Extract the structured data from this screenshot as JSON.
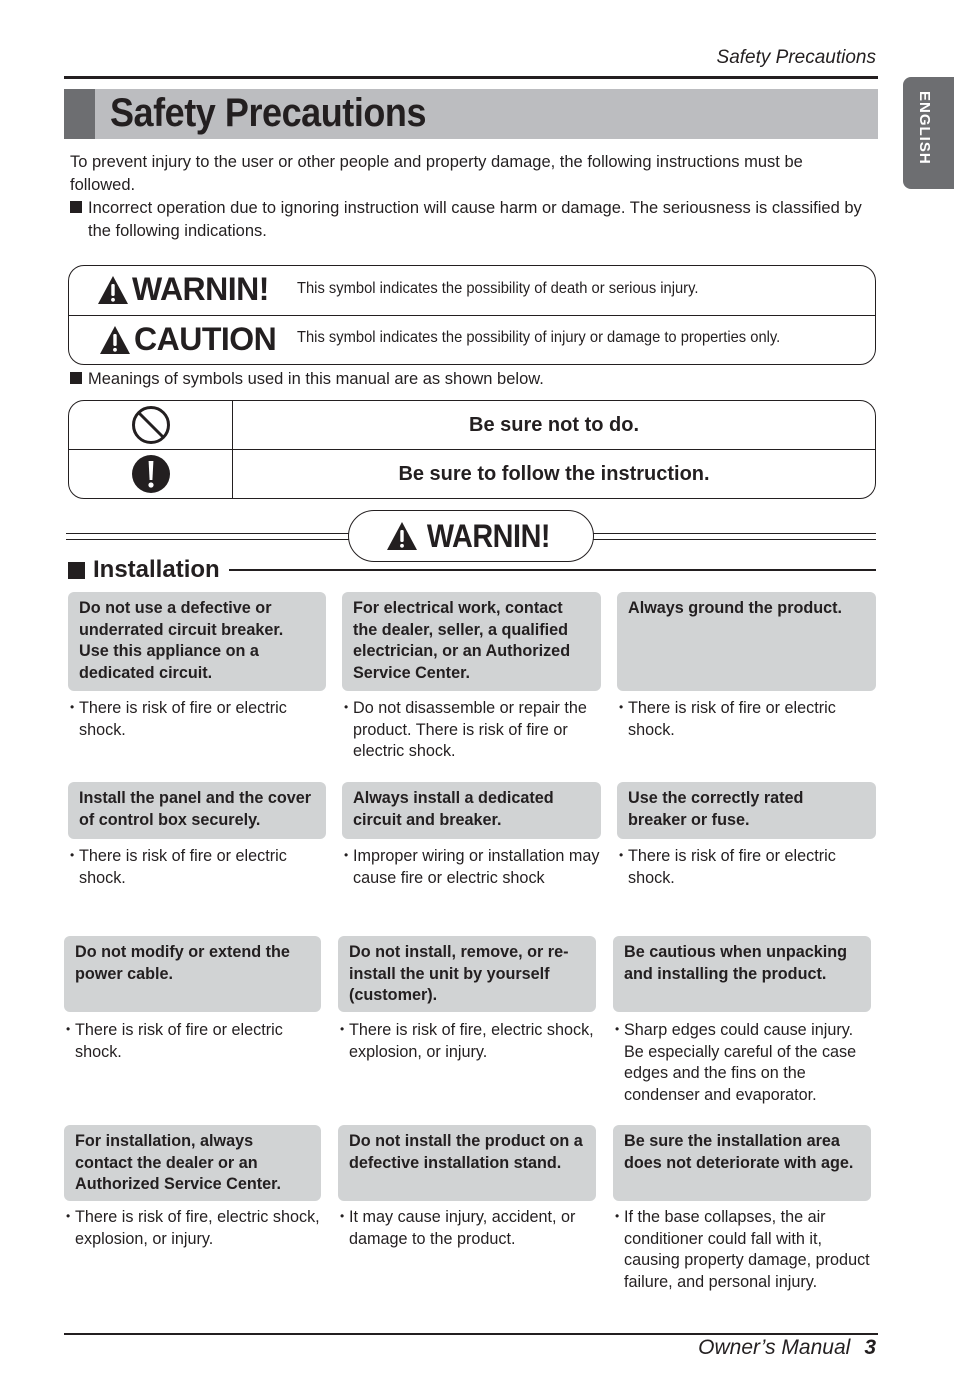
{
  "header": {
    "running_title": "Safety Precautions",
    "page_title": "Safety Precautions",
    "language_tab": "ENGLISH"
  },
  "intro": {
    "paragraph": "To prevent injury to the user or other people and property damage, the following instructions must be followed.",
    "bullet": "Incorrect operation due to ignoring instruction will cause harm or damage. The seriousness is classified by the following indications."
  },
  "severity_legend": [
    {
      "label": "WARNIN!",
      "icon": "warning-triangle-icon",
      "description": "This symbol indicates the possibility of death or serious injury."
    },
    {
      "label": "CAUTION",
      "icon": "warning-triangle-icon",
      "description": "This symbol indicates the possibility of injury or damage to properties only."
    }
  ],
  "symbols_note": "Meanings of symbols used in this manual are as shown below.",
  "symbols": [
    {
      "icon": "prohibited-icon",
      "meaning": "Be sure not to do."
    },
    {
      "icon": "mandatory-exclamation-icon",
      "meaning": "Be sure to follow the instruction."
    }
  ],
  "warning_banner": {
    "label": "WARNIN!",
    "icon": "warning-triangle-icon"
  },
  "section": {
    "title": "Installation",
    "items": [
      {
        "heading": "Do not use a defective or underrated circuit breaker. Use this appliance on a dedicated circuit.",
        "note": "There is risk of fire or electric shock."
      },
      {
        "heading": "For electrical work, contact the dealer, seller, a qualified electrician, or an Authorized Service Center.",
        "note": "Do not disassemble or repair the product. There is risk of fire or electric shock."
      },
      {
        "heading": "Always ground the product.",
        "note": "There is risk of fire or electric shock."
      },
      {
        "heading": "Install the panel and the cover of control box securely.",
        "note": "There is risk of fire or electric shock."
      },
      {
        "heading": "Always install a dedicated circuit and breaker.",
        "note": "Improper wiring or installation may cause fire or electric shock"
      },
      {
        "heading": "Use the correctly rated breaker or fuse.",
        "note": "There is risk of fire or electric shock."
      },
      {
        "heading": "Do not modify or extend the power cable.",
        "note": "There is risk of fire or electric shock."
      },
      {
        "heading": "Do not install, remove, or re-install the unit by yourself (customer).",
        "note": "There is risk of fire, electric shock, explosion, or injury."
      },
      {
        "heading": "Be cautious when unpacking and installing  the product.",
        "note": "Sharp edges could cause injury. Be especially careful of the case edges and the fins on the condenser and evaporator."
      },
      {
        "heading": "For installation, always contact the dealer or an Authorized Service Center.",
        "note": "There is risk of fire, electric shock, explosion, or injury."
      },
      {
        "heading": "Do not install the product on a defective installation stand.",
        "note": "It may cause injury, accident, or damage to the product."
      },
      {
        "heading": "Be sure the installation area does not deteriorate with age.",
        "note": "If the base collapses, the air conditioner could fall with it, causing property damage, product failure, and personal injury."
      }
    ]
  },
  "footer": {
    "manual_label": "Owner’s Manual",
    "page_number": "3"
  }
}
